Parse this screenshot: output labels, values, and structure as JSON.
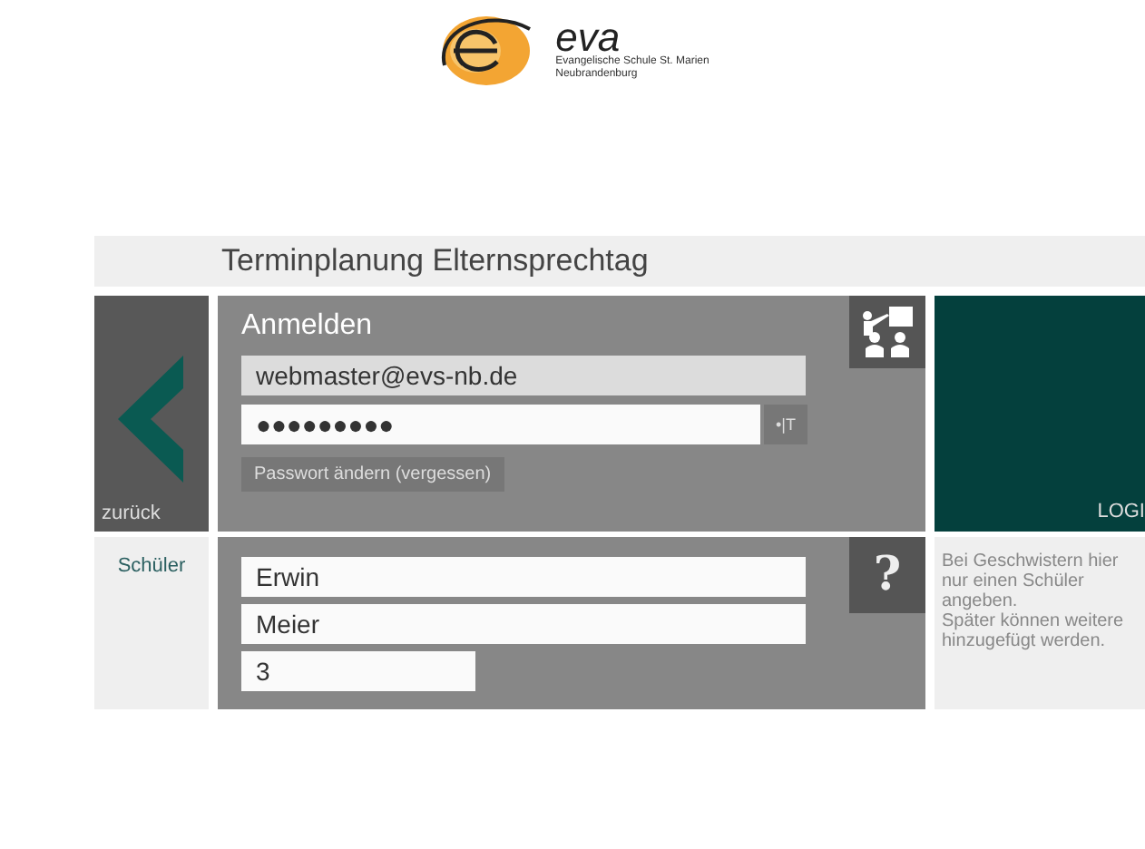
{
  "logo": {
    "name": "eva",
    "line_1": "Evangelische Schule St. Marien",
    "line_2": "Neubrandenburg"
  },
  "title": "Terminplanung Elternsprechtag",
  "back": {
    "label": "zurück"
  },
  "login": {
    "heading": "Anmelden",
    "email": "webmaster@evs-nb.de",
    "password": "●●●●●●●●●",
    "toggle": "•|T",
    "change_password": "Passwort ändern (vergessen)",
    "submit": "LOGI"
  },
  "student": {
    "label": "Schüler",
    "first_name": "Erwin",
    "last_name": "Meier",
    "class": "3",
    "help": "?",
    "hint": "Bei Geschwistern hier nur einen Schüler angeben.\nSpäter können weitere hinzugefügt werden."
  }
}
